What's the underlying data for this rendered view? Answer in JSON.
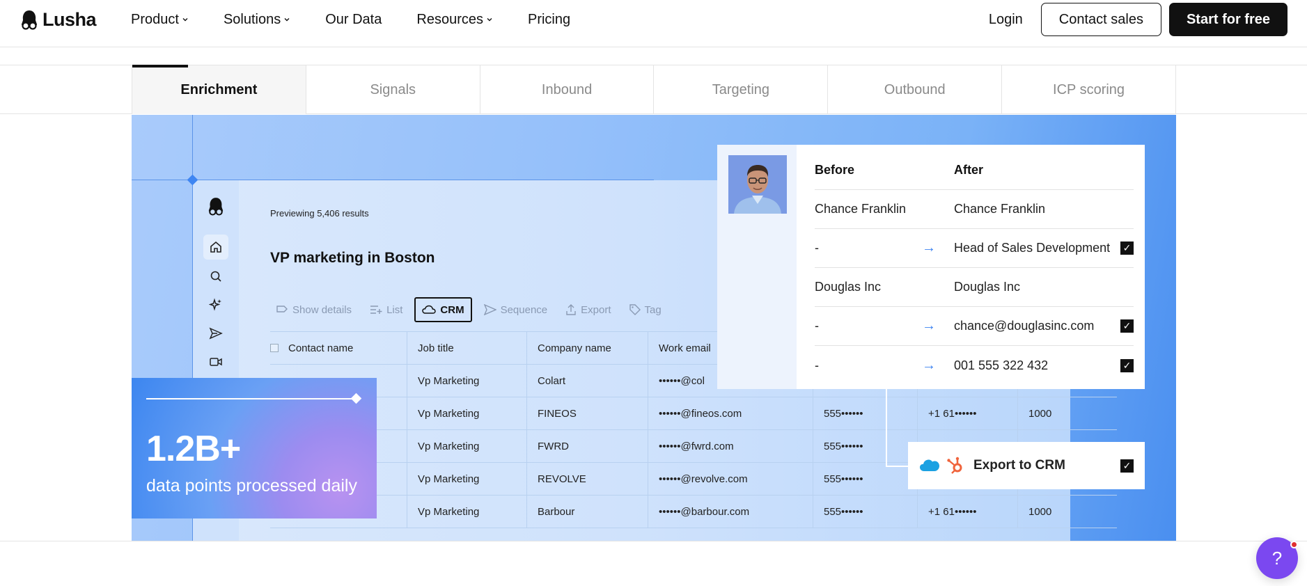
{
  "nav": {
    "logo_text": "Lusha",
    "links": [
      {
        "label": "Product",
        "has_dropdown": true
      },
      {
        "label": "Solutions",
        "has_dropdown": true
      },
      {
        "label": "Our Data",
        "has_dropdown": false
      },
      {
        "label": "Resources",
        "has_dropdown": true
      },
      {
        "label": "Pricing",
        "has_dropdown": false
      }
    ],
    "login": "Login",
    "contact_sales": "Contact sales",
    "start_free": "Start for free"
  },
  "tabs": [
    "Enrichment",
    "Signals",
    "Inbound",
    "Targeting",
    "Outbound",
    "ICP scoring"
  ],
  "active_tab": "Enrichment",
  "app": {
    "side_icons": [
      "lusha-logo-icon",
      "home-icon",
      "search-icon",
      "sparkle-icon",
      "send-icon",
      "video-icon"
    ],
    "preview": "Previewing 5,406 results",
    "title": "VP marketing in Boston",
    "toolbar": {
      "show_details": "Show details",
      "list": "List",
      "crm": "CRM",
      "sequence": "Sequence",
      "export": "Export",
      "tag": "Tag"
    },
    "table": {
      "headers": [
        "Contact name",
        "Job title",
        "Company name",
        "Work email"
      ],
      "rows": [
        [
          "",
          "Vp Marketing",
          "Colart",
          "••••••@col",
          "",
          "",
          ""
        ],
        [
          "",
          "Vp Marketing",
          "FINEOS",
          "••••••@fineos.com",
          "555••••••",
          "+1 61••••••",
          "1000"
        ],
        [
          "",
          "Vp Marketing",
          "FWRD",
          "••••••@fwrd.com",
          "555••••••",
          "",
          ""
        ],
        [
          "",
          "Vp Marketing",
          "REVOLVE",
          "••••••@revolve.com",
          "555••••••",
          "",
          ""
        ],
        [
          "",
          "Vp Marketing",
          "Barbour",
          "••••••@barbour.com",
          "555••••••",
          "+1 61••••••",
          "1000"
        ]
      ]
    }
  },
  "stat": {
    "value": "1.2B+",
    "label": "data points processed daily"
  },
  "before_after": {
    "before_header": "Before",
    "after_header": "After",
    "rows": [
      {
        "before": "Chance Franklin",
        "after": "Chance Franklin",
        "changed": false
      },
      {
        "before": "-",
        "after": "Head of Sales Development",
        "changed": true
      },
      {
        "before": "Douglas Inc",
        "after": "Douglas Inc",
        "changed": false
      },
      {
        "before": "-",
        "after": "chance@douglasinc.com",
        "changed": true
      },
      {
        "before": "-",
        "after": "001 555 322 432",
        "changed": true
      }
    ]
  },
  "export": {
    "label": "Export to CRM"
  },
  "help": "?",
  "colors": {
    "accent_blue": "#3b82f0",
    "help_purple": "#7b48f0",
    "dark": "#111111"
  }
}
